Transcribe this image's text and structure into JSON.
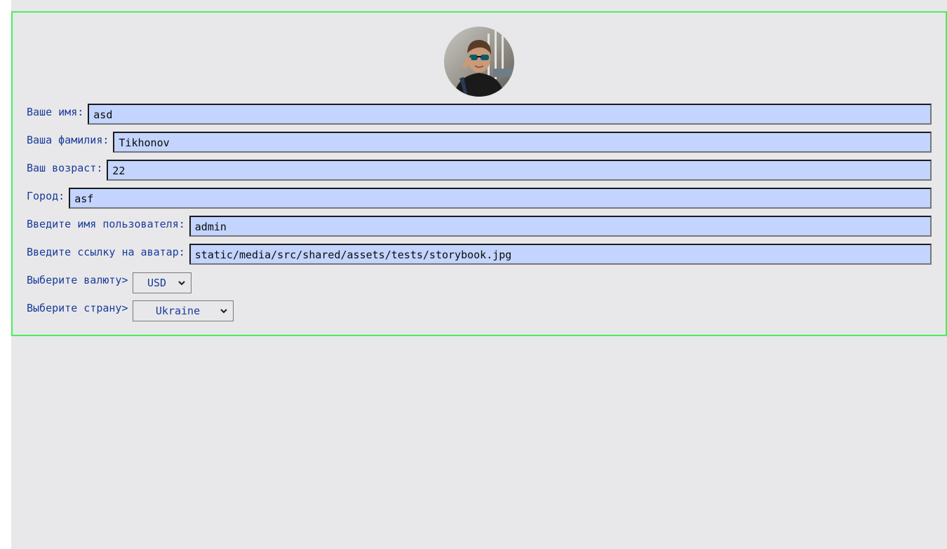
{
  "profile": {
    "avatar_alt": "avatar",
    "fields": {
      "first_name_label": "Ваше имя:",
      "first_name_value": "asd",
      "last_name_label": "Ваша фамилия:",
      "last_name_value": "Tikhonov",
      "age_label": "Ваш возраст:",
      "age_value": "22",
      "city_label": "Город:",
      "city_value": "asf",
      "username_label": "Введите имя пользователя:",
      "username_value": "admin",
      "avatar_label": "Введите ссылку на аватар:",
      "avatar_value": "static/media/src/shared/assets/tests/storybook.jpg",
      "currency_label": "Выберите валюту>",
      "currency_value": "USD",
      "country_label": "Выберите страну>",
      "country_value": "Ukraine"
    }
  },
  "colors": {
    "card_border": "#46f05a",
    "background": "#e8e8ea",
    "input_bg": "#c3d4ff",
    "label_color": "#1a3a9a"
  }
}
